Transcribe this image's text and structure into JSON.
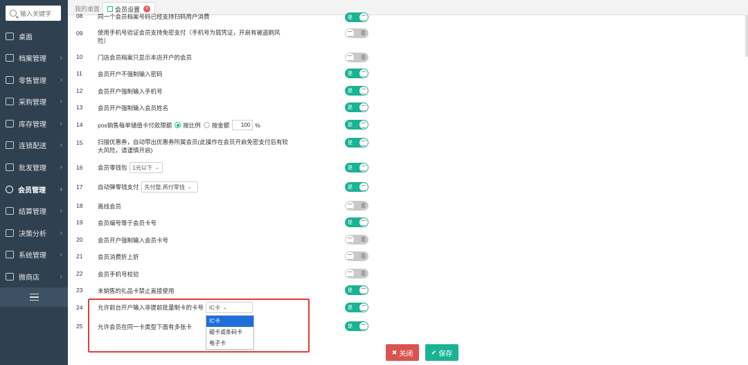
{
  "search": {
    "placeholder": "输入关键字"
  },
  "sidebar": {
    "items": [
      {
        "label": "桌面",
        "chevron": false,
        "active": false,
        "icon": "desktop-icon"
      },
      {
        "label": "档案管理",
        "chevron": true,
        "active": false,
        "icon": "archive-icon"
      },
      {
        "label": "零售管理",
        "chevron": true,
        "active": false,
        "icon": "retail-icon"
      },
      {
        "label": "采购管理",
        "chevron": true,
        "active": false,
        "icon": "purchase-icon"
      },
      {
        "label": "库存管理",
        "chevron": true,
        "active": false,
        "icon": "inventory-icon"
      },
      {
        "label": "连锁配送",
        "chevron": true,
        "active": false,
        "icon": "delivery-icon"
      },
      {
        "label": "批发管理",
        "chevron": true,
        "active": false,
        "icon": "wholesale-icon"
      },
      {
        "label": "会员管理",
        "chevron": true,
        "active": true,
        "icon": "member-icon"
      },
      {
        "label": "结算管理",
        "chevron": true,
        "active": false,
        "icon": "settlement-icon"
      },
      {
        "label": "决策分析",
        "chevron": true,
        "active": false,
        "icon": "analysis-icon"
      },
      {
        "label": "系统管理",
        "chevron": true,
        "active": false,
        "icon": "system-icon"
      },
      {
        "label": "微商店",
        "chevron": true,
        "active": false,
        "icon": "micro-store-icon"
      }
    ],
    "chevron_glyph": "›"
  },
  "tabs": {
    "home": "我的桌面",
    "member_settings": "会员设置",
    "close_glyph": "×"
  },
  "toggle_text": {
    "on": "是",
    "off": "否"
  },
  "settings": [
    {
      "num": "08",
      "label": "同一个会员档案号码已经支持扫码用户消费",
      "state": "on"
    },
    {
      "num": "09",
      "label": "使用手机号验证会员支持免密支付（手机号为弱凭证，开启有被盗刷风险）",
      "state": "off"
    },
    {
      "num": "10",
      "label": "门店会员档案只显示本店开户的会员",
      "state": "off"
    },
    {
      "num": "11",
      "label": "会员开户不强制输入密码",
      "state": "on"
    },
    {
      "num": "12",
      "label": "会员开户强制输入手机号",
      "state": "on"
    },
    {
      "num": "13",
      "label": "会员开户强制输入会员姓名",
      "state": "on"
    },
    {
      "num": "14",
      "label": "pos销售每单储值卡付款限额",
      "state": "on"
    },
    {
      "num": "15",
      "label": "扫描优惠券，自动带出优惠券所属会员(此操作在会员开启免密支付后有较大风险，请谨慎开启)",
      "state": "on"
    },
    {
      "num": "16",
      "label": "会员零钱包",
      "state": "on"
    },
    {
      "num": "17",
      "label": "自动弹零钱支付",
      "state": "on"
    },
    {
      "num": "18",
      "label": "离线会员",
      "state": "off"
    },
    {
      "num": "19",
      "label": "会员编号等于会员卡号",
      "state": "on"
    },
    {
      "num": "20",
      "label": "会员开户强制输入会员卡号",
      "state": "off"
    },
    {
      "num": "21",
      "label": "会员消费折上折",
      "state": "off"
    },
    {
      "num": "22",
      "label": "会员手机号校验",
      "state": "off"
    },
    {
      "num": "23",
      "label": "未销售的礼品卡禁止直接使用",
      "state": "on"
    },
    {
      "num": "24",
      "label": "允许前台开户输入非提前批量制卡的卡号",
      "state": "on"
    },
    {
      "num": "25",
      "label": "允许会员在同一卡类型下面有多张卡",
      "state": "on"
    }
  ],
  "row14": {
    "radio_ratio": "按比例",
    "radio_amount": "按金额",
    "value": "100",
    "unit": "%"
  },
  "row16": {
    "select_value": "1元以下"
  },
  "row17": {
    "select_value": "先付整,再付零钱"
  },
  "row24": {
    "select_value": "IC卡",
    "options": [
      "IC卡",
      "磁卡或条码卡",
      "电子卡"
    ]
  },
  "buttons": {
    "close": "关闭",
    "save": "保存"
  },
  "colors": {
    "sidebar": "#2f4050",
    "accent": "#1ab394",
    "danger": "#d9534f",
    "highlight": "#e23b3b"
  }
}
